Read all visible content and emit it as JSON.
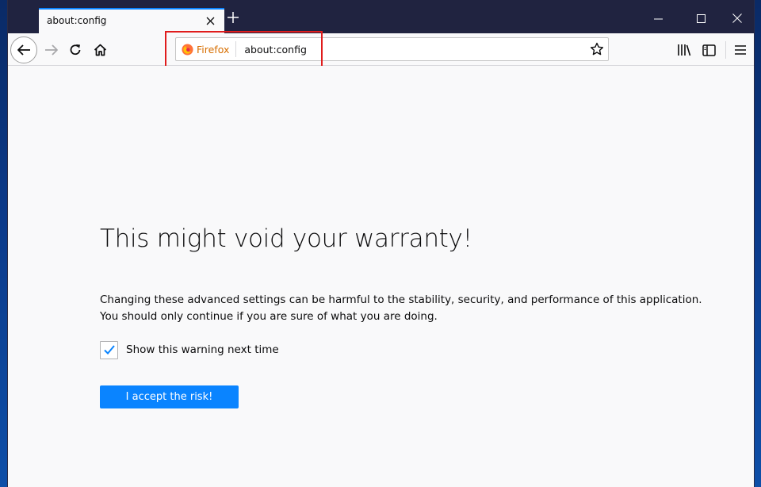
{
  "tab": {
    "title": "about:config",
    "close_icon": "close-icon"
  },
  "window_controls": {
    "minimize": "minimize-icon",
    "maximize": "maximize-icon",
    "close": "close-icon"
  },
  "toolbar": {
    "identity_label": "Firefox",
    "url": "about:config",
    "icons": [
      "back-icon",
      "forward-icon",
      "reload-icon",
      "home-icon",
      "bookmark-star-icon",
      "library-icon",
      "sidebar-icon",
      "menu-icon"
    ]
  },
  "content": {
    "title": "This might void your warranty!",
    "description": "Changing these advanced settings can be harmful to the stability, security, and performance of this application. You should only continue if you are sure of what you are doing.",
    "checkbox_label": "Show this warning next time",
    "checkbox_checked": true,
    "accept_button": "I accept the risk!"
  },
  "colors": {
    "accent": "#0a84ff",
    "highlight": "#e01c1c",
    "tabstrip": "#202340",
    "identity": "#d76e00"
  }
}
